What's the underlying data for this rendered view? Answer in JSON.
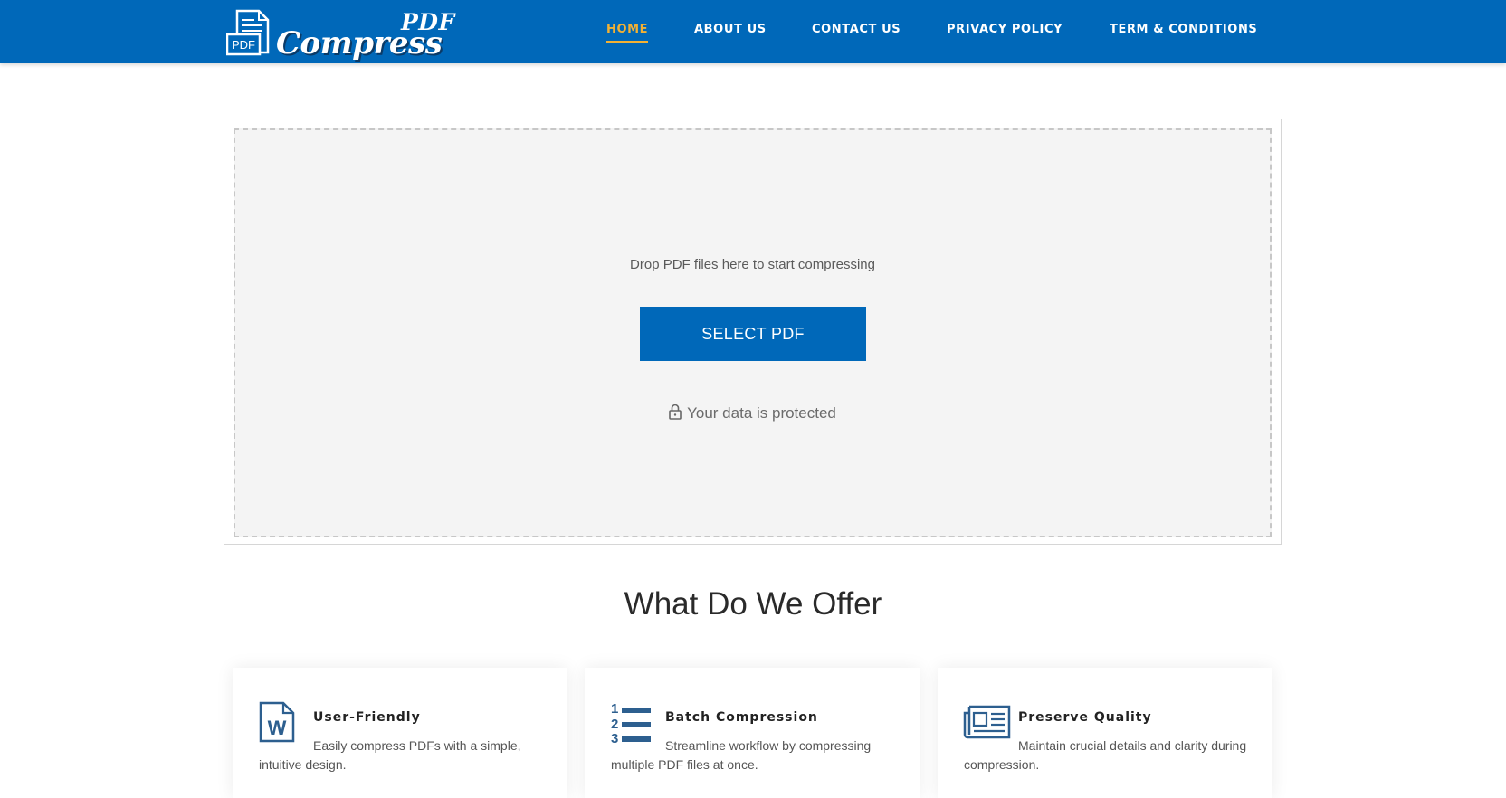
{
  "header": {
    "logo_pdf": "PDF",
    "logo_compress": "Compress",
    "logo_doc_label": "PDF",
    "nav": [
      {
        "label": "HOME",
        "active": true
      },
      {
        "label": "ABOUT US",
        "active": false
      },
      {
        "label": "CONTACT US",
        "active": false
      },
      {
        "label": "PRIVACY POLICY",
        "active": false
      },
      {
        "label": "TERM & CONDITIONS",
        "active": false
      }
    ]
  },
  "upload": {
    "drop_text": "Drop PDF files here to start compressing",
    "select_label": "SELECT PDF",
    "protected_text": "Your data is protected"
  },
  "offer": {
    "title": "What Do We Offer",
    "cards": [
      {
        "icon": "word-document-icon",
        "title": "User-Friendly",
        "text": "Easily compress PDFs with a simple, intuitive design."
      },
      {
        "icon": "numbered-list-icon",
        "title": "Batch Compression",
        "text": "Streamline workflow by compressing multiple PDF files at once."
      },
      {
        "icon": "newspaper-icon",
        "title": "Preserve Quality",
        "text": "Maintain crucial details and clarity during compression."
      }
    ]
  },
  "colors": {
    "brand_blue": "#0068b9",
    "active_nav": "#f2b134",
    "icon_blue": "#2d5f8f"
  }
}
